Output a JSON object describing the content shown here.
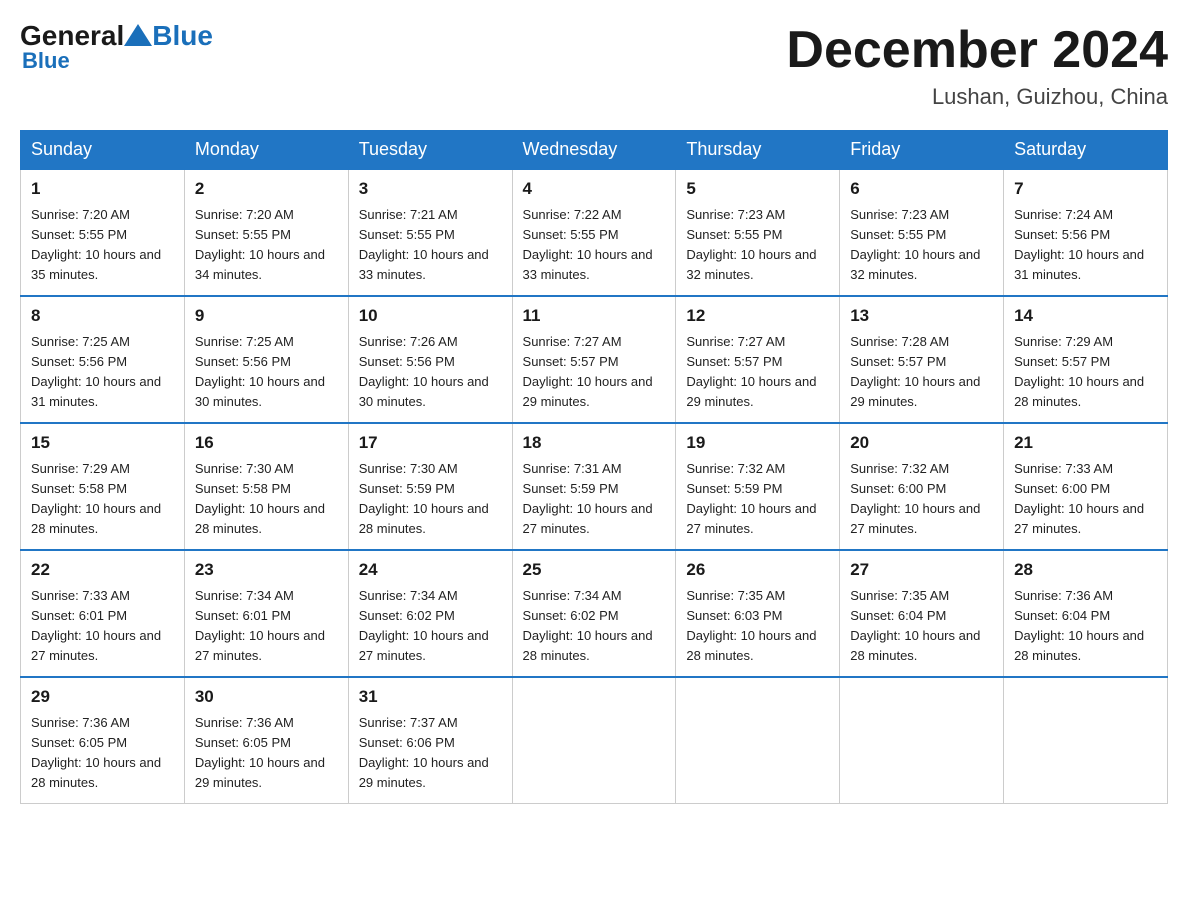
{
  "header": {
    "logo_general": "General",
    "logo_blue": "Blue",
    "month_title": "December 2024",
    "location": "Lushan, Guizhou, China"
  },
  "weekdays": [
    "Sunday",
    "Monday",
    "Tuesday",
    "Wednesday",
    "Thursday",
    "Friday",
    "Saturday"
  ],
  "weeks": [
    [
      {
        "day": "1",
        "sunrise": "7:20 AM",
        "sunset": "5:55 PM",
        "daylight": "10 hours and 35 minutes."
      },
      {
        "day": "2",
        "sunrise": "7:20 AM",
        "sunset": "5:55 PM",
        "daylight": "10 hours and 34 minutes."
      },
      {
        "day": "3",
        "sunrise": "7:21 AM",
        "sunset": "5:55 PM",
        "daylight": "10 hours and 33 minutes."
      },
      {
        "day": "4",
        "sunrise": "7:22 AM",
        "sunset": "5:55 PM",
        "daylight": "10 hours and 33 minutes."
      },
      {
        "day": "5",
        "sunrise": "7:23 AM",
        "sunset": "5:55 PM",
        "daylight": "10 hours and 32 minutes."
      },
      {
        "day": "6",
        "sunrise": "7:23 AM",
        "sunset": "5:55 PM",
        "daylight": "10 hours and 32 minutes."
      },
      {
        "day": "7",
        "sunrise": "7:24 AM",
        "sunset": "5:56 PM",
        "daylight": "10 hours and 31 minutes."
      }
    ],
    [
      {
        "day": "8",
        "sunrise": "7:25 AM",
        "sunset": "5:56 PM",
        "daylight": "10 hours and 31 minutes."
      },
      {
        "day": "9",
        "sunrise": "7:25 AM",
        "sunset": "5:56 PM",
        "daylight": "10 hours and 30 minutes."
      },
      {
        "day": "10",
        "sunrise": "7:26 AM",
        "sunset": "5:56 PM",
        "daylight": "10 hours and 30 minutes."
      },
      {
        "day": "11",
        "sunrise": "7:27 AM",
        "sunset": "5:57 PM",
        "daylight": "10 hours and 29 minutes."
      },
      {
        "day": "12",
        "sunrise": "7:27 AM",
        "sunset": "5:57 PM",
        "daylight": "10 hours and 29 minutes."
      },
      {
        "day": "13",
        "sunrise": "7:28 AM",
        "sunset": "5:57 PM",
        "daylight": "10 hours and 29 minutes."
      },
      {
        "day": "14",
        "sunrise": "7:29 AM",
        "sunset": "5:57 PM",
        "daylight": "10 hours and 28 minutes."
      }
    ],
    [
      {
        "day": "15",
        "sunrise": "7:29 AM",
        "sunset": "5:58 PM",
        "daylight": "10 hours and 28 minutes."
      },
      {
        "day": "16",
        "sunrise": "7:30 AM",
        "sunset": "5:58 PM",
        "daylight": "10 hours and 28 minutes."
      },
      {
        "day": "17",
        "sunrise": "7:30 AM",
        "sunset": "5:59 PM",
        "daylight": "10 hours and 28 minutes."
      },
      {
        "day": "18",
        "sunrise": "7:31 AM",
        "sunset": "5:59 PM",
        "daylight": "10 hours and 27 minutes."
      },
      {
        "day": "19",
        "sunrise": "7:32 AM",
        "sunset": "5:59 PM",
        "daylight": "10 hours and 27 minutes."
      },
      {
        "day": "20",
        "sunrise": "7:32 AM",
        "sunset": "6:00 PM",
        "daylight": "10 hours and 27 minutes."
      },
      {
        "day": "21",
        "sunrise": "7:33 AM",
        "sunset": "6:00 PM",
        "daylight": "10 hours and 27 minutes."
      }
    ],
    [
      {
        "day": "22",
        "sunrise": "7:33 AM",
        "sunset": "6:01 PM",
        "daylight": "10 hours and 27 minutes."
      },
      {
        "day": "23",
        "sunrise": "7:34 AM",
        "sunset": "6:01 PM",
        "daylight": "10 hours and 27 minutes."
      },
      {
        "day": "24",
        "sunrise": "7:34 AM",
        "sunset": "6:02 PM",
        "daylight": "10 hours and 27 minutes."
      },
      {
        "day": "25",
        "sunrise": "7:34 AM",
        "sunset": "6:02 PM",
        "daylight": "10 hours and 28 minutes."
      },
      {
        "day": "26",
        "sunrise": "7:35 AM",
        "sunset": "6:03 PM",
        "daylight": "10 hours and 28 minutes."
      },
      {
        "day": "27",
        "sunrise": "7:35 AM",
        "sunset": "6:04 PM",
        "daylight": "10 hours and 28 minutes."
      },
      {
        "day": "28",
        "sunrise": "7:36 AM",
        "sunset": "6:04 PM",
        "daylight": "10 hours and 28 minutes."
      }
    ],
    [
      {
        "day": "29",
        "sunrise": "7:36 AM",
        "sunset": "6:05 PM",
        "daylight": "10 hours and 28 minutes."
      },
      {
        "day": "30",
        "sunrise": "7:36 AM",
        "sunset": "6:05 PM",
        "daylight": "10 hours and 29 minutes."
      },
      {
        "day": "31",
        "sunrise": "7:37 AM",
        "sunset": "6:06 PM",
        "daylight": "10 hours and 29 minutes."
      },
      null,
      null,
      null,
      null
    ]
  ]
}
